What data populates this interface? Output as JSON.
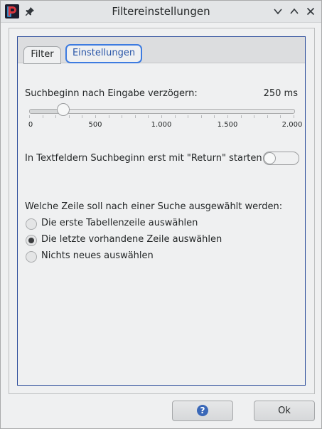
{
  "window": {
    "title": "Filtereinstellungen",
    "icons": [
      "app-logo-icon",
      "pin-icon",
      "chevron-down-icon",
      "chevron-up-icon",
      "close-icon"
    ]
  },
  "tabs": [
    {
      "label": "Filter",
      "active": false
    },
    {
      "label": "Einstellungen",
      "active": true
    }
  ],
  "delay": {
    "label": "Suchbeginn nach Eingabe verzögern:",
    "value_text": "250 ms",
    "value": 250,
    "min": 0,
    "max": 2000,
    "tick_labels": [
      "0",
      "500",
      "1.000",
      "1.500",
      "2.000"
    ]
  },
  "return_toggle": {
    "label": "In Textfeldern Suchbeginn erst mit \"Return\" starten",
    "checked": false
  },
  "selection": {
    "label": "Welche Zeile soll nach einer Suche ausgewählt werden:",
    "options": [
      {
        "label": "Die erste Tabellenzeile auswählen",
        "checked": false
      },
      {
        "label": "Die letzte vorhandene Zeile auswählen",
        "checked": true
      },
      {
        "label": "Nichts neues auswählen",
        "checked": false
      }
    ]
  },
  "buttons": {
    "help_glyph": "?",
    "ok_label": "Ok"
  },
  "colors": {
    "accent": "#3d7be0",
    "frame_blue": "#2e4e9c",
    "help_blue": "#3a68b8"
  }
}
